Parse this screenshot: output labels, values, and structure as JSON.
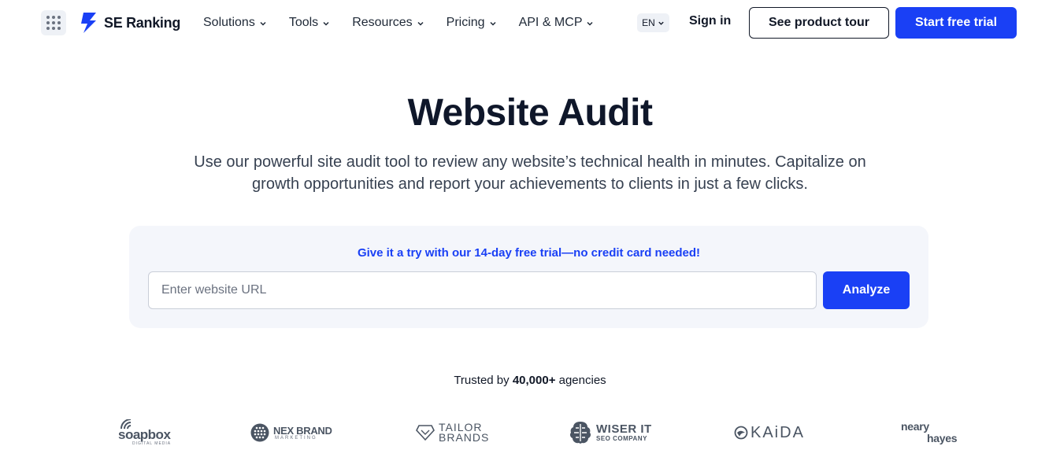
{
  "header": {
    "apps_icon": "apps-grid-icon",
    "brand_name": "SE Ranking",
    "nav": [
      {
        "label": "Solutions"
      },
      {
        "label": "Tools"
      },
      {
        "label": "Resources"
      },
      {
        "label": "Pricing"
      },
      {
        "label": "API & MCP"
      }
    ],
    "language": "EN",
    "sign_in": "Sign in",
    "product_tour": "See product tour",
    "free_trial": "Start free trial"
  },
  "hero": {
    "title": "Website Audit",
    "subtitle_line1": "Use our powerful site audit tool to review any website’s technical health in minutes. Capitalize on",
    "subtitle_line2": "growth opportunities and report your achievements to clients in just a few clicks."
  },
  "form": {
    "note": "Give it a try with our 14-day free trial—no credit card needed!",
    "url_value": "",
    "url_placeholder": "Enter website URL",
    "analyze_label": "Analyze"
  },
  "trusted": {
    "prefix": "Trusted by",
    "count": "40,000+",
    "suffix": "agencies"
  },
  "client_logos": {
    "soapbox": {
      "name": "soapbox",
      "tag": "DIGITAL MEDIA"
    },
    "nexbrand": {
      "name": "NEX BRAND",
      "tag": "MARKETING"
    },
    "tailor": {
      "line1": "TAILOR",
      "line2": "BRANDS"
    },
    "wiser": {
      "name": "WISER IT",
      "tag": "SEO COMPANY"
    },
    "kaida": {
      "name": "KAiDA"
    },
    "neary": {
      "line1": "neary",
      "line2": "hayes"
    }
  },
  "colors": {
    "accent": "#1a40f5",
    "text": "#111827",
    "card_bg": "#f4f6fb"
  }
}
